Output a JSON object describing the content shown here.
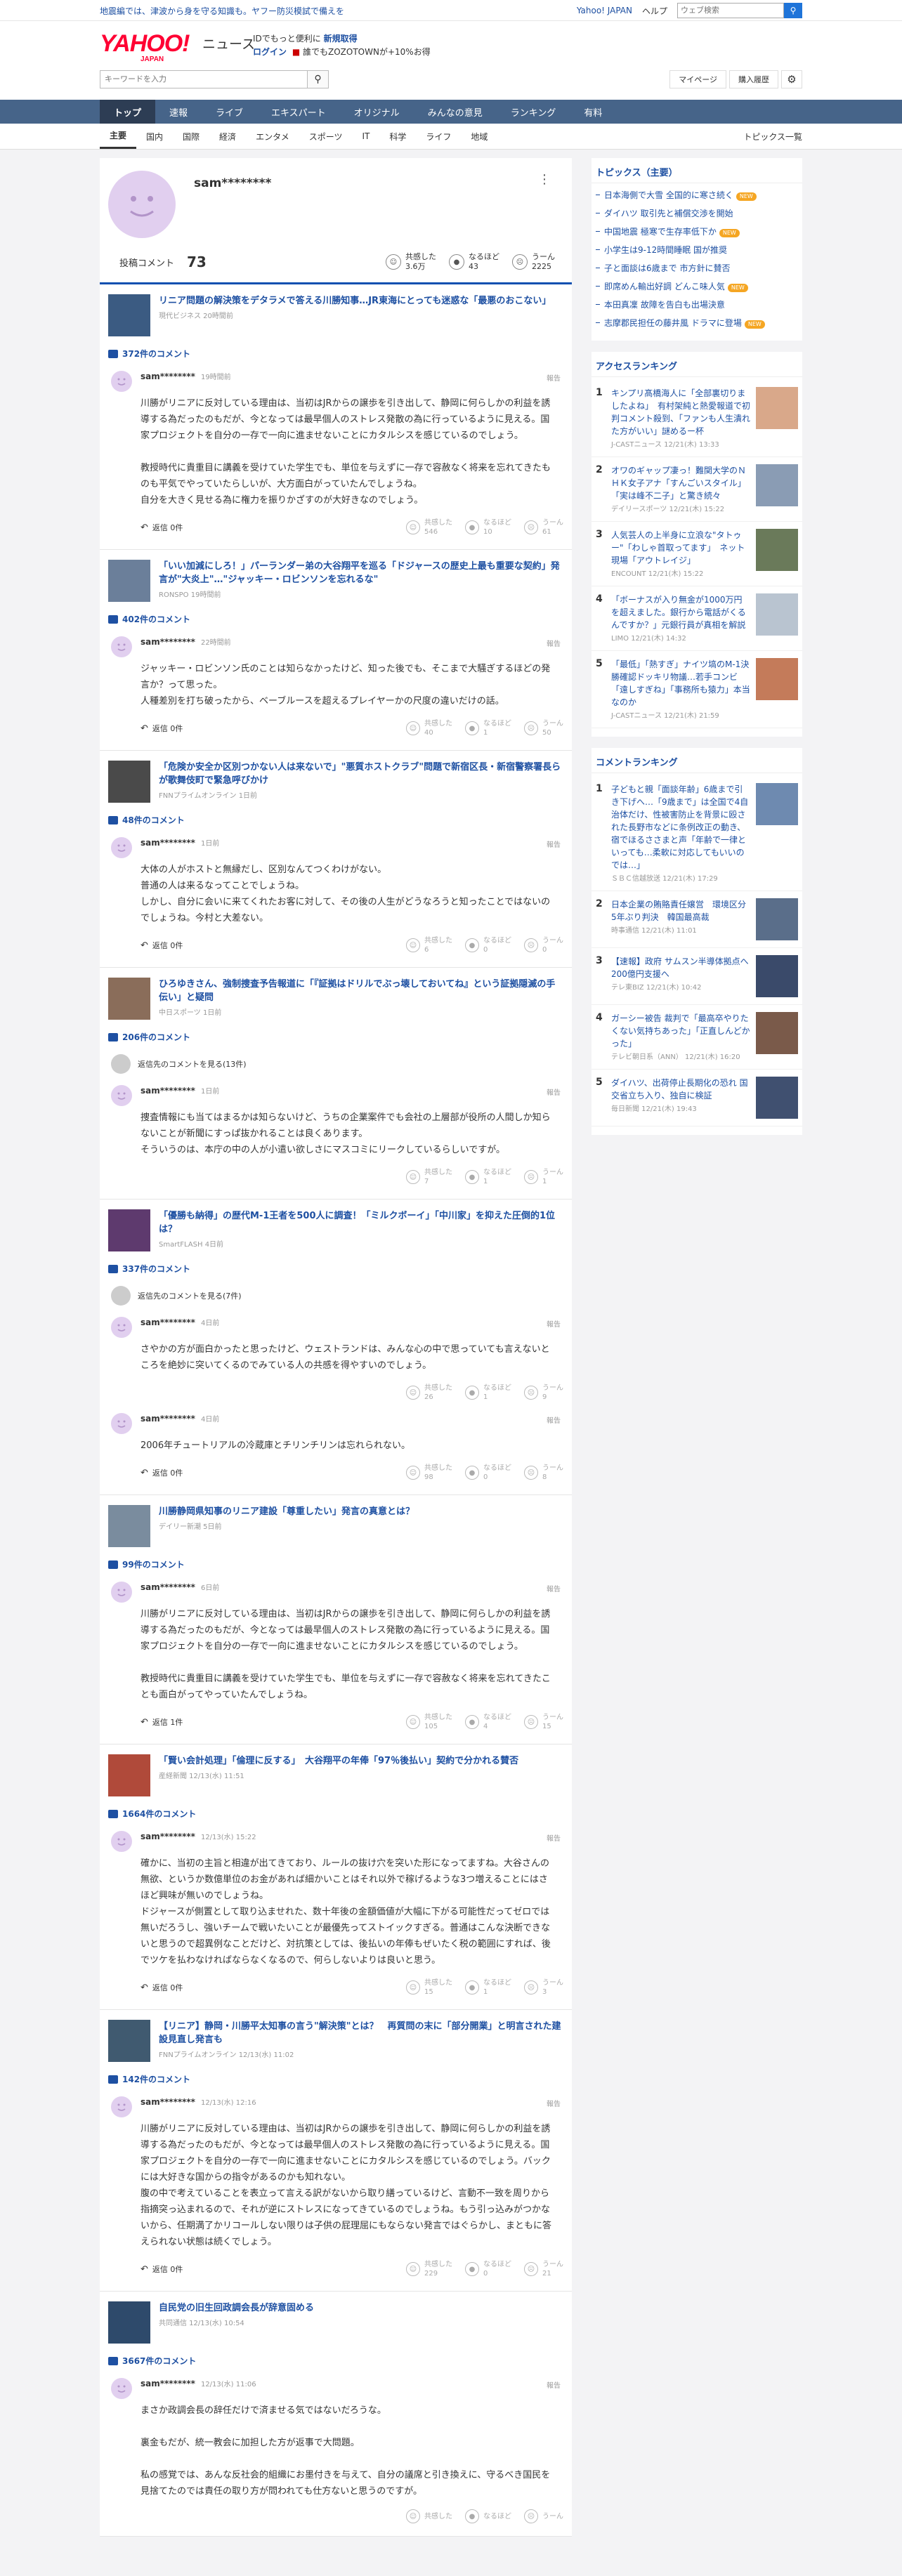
{
  "notice": {
    "text": "地震編では、津波から身を守る知識も。ヤフー防災模試で備えを",
    "yahoo_japan": "Yahoo! JAPAN",
    "help": "ヘルプ",
    "search_placeholder": "ウェブ検索"
  },
  "header": {
    "logo": "YAHOO!",
    "logo_sub": "JAPAN",
    "service": "ニュース",
    "promo1_a": "IDでもっと便利に",
    "promo1_b": "新規取得",
    "login": "ログイン",
    "promo2": "誰でもZOZOTOWNが+10%お得",
    "keyword_placeholder": "キーワードを入力",
    "mypage": "マイページ",
    "history": "購入履歴"
  },
  "nav_main": [
    "トップ",
    "速報",
    "ライブ",
    "エキスパート",
    "オリジナル",
    "みんなの意見",
    "ランキング",
    "有料"
  ],
  "nav_sub": [
    "主要",
    "国内",
    "国際",
    "経済",
    "エンタメ",
    "スポーツ",
    "IT",
    "科学",
    "ライフ",
    "地域"
  ],
  "nav_sub_all": "トピックス一覧",
  "profile": {
    "username": "sam********",
    "posts_label": "投稿コメント",
    "posts_count": "73",
    "reactions": [
      {
        "label": "共感した",
        "value": "3.6万"
      },
      {
        "label": "なるほど",
        "value": "43"
      },
      {
        "label": "うーん",
        "value": "2225"
      }
    ]
  },
  "labels": {
    "reply": "返信",
    "report": "報告",
    "agree": "共感した",
    "naruhodo": "なるほど",
    "uun": "うーん"
  },
  "articles": [
    {
      "title": "リニア問題の解決策をデタラメで答える川勝知事…JR東海にとっても迷惑な「最悪のおこない」",
      "source": "現代ビジネス 20時間前",
      "comment_count": "372件のコメント",
      "comments": [
        {
          "user": "sam********",
          "time": "19時間前",
          "body": "川勝がリニアに反対している理由は、当初はJRからの譲歩を引き出して、静岡に何らしかの利益を誘導する為だったのもだが、今となっては最早個人のストレス発散の為に行っているように見える。国家プロジェクトを自分の一存で一向に進ませないことにカタルシスを感じているのでしょう。\n\n教授時代に貴重目に講義を受けていた学生でも、単位を与えずに一存で容赦なく将来を忘れてきたものも平気でやっていたらしいが、大方面白がっていたんでしょうね。\n自分を大きく見せる為に権力を振りかざすのが大好きなのでしょう。",
          "replies": "返信 0件",
          "r": [
            "546",
            "10",
            "61"
          ]
        }
      ]
    },
    {
      "title": "「いい加減にしろ！」パーランダー弟の大谷翔平を巡る「ドジャースの歴史上最も重要な契約」発言が\"大炎上\"…\"ジャッキー・ロビンソンを忘れるな\"",
      "source": "RONSPO 19時間前",
      "comment_count": "402件のコメント",
      "comments": [
        {
          "user": "sam********",
          "time": "22時間前",
          "body": "ジャッキー・ロビンソン氏のことは知らなかったけど、知った後でも、そこまで大騒ぎするほどの発言か？って思った。\n人種差別を打ち破ったから、ベーブルースを超えるプレイヤーかの尺度の違いだけの話。",
          "replies": "返信 0件",
          "r": [
            "40",
            "1",
            "50"
          ]
        }
      ]
    },
    {
      "title": "「危険か安全か区別つかない人は来ないで」\"悪質ホストクラブ\"問題で新宿区長・新宿警察署長らが歌舞伎町で緊急呼びかけ",
      "source": "FNNプライムオンライン 1日前",
      "comment_count": "48件のコメント",
      "comments": [
        {
          "user": "sam********",
          "time": "1日前",
          "body": "大体の人がホストと無縁だし、区別なんてつくわけがない。\n普通の人は来るなってことでしょうね。\nしかし、自分に会いに来てくれたお客に対して、その後の人生がどうなろうと知ったことではないのでしょうね。今村と大差ない。",
          "replies": "返信 0件",
          "r": [
            "6",
            "0",
            "0"
          ]
        }
      ]
    },
    {
      "title": "ひろゆきさん、強制捜査予告報道に「『証拠はドリルでぶっ壊しておいてね』という証拠隠滅の手伝い」と疑問",
      "source": "中日スポーツ 1日前",
      "comment_count": "206件のコメント",
      "see_parent": "返信先のコメントを見る(13件)",
      "comments": [
        {
          "user": "sam********",
          "time": "1日前",
          "body": "捜査情報にも当てはまるかは知らないけど、うちの企業案件でも会社の上層部が役所の人間しか知らないことが新聞にすっぱ抜かれることは良くあります。\nそういうのは、本庁の中の人が小遣い欲しさにマスコミにリークしているらしいですが。",
          "replies": "",
          "r": [
            "7",
            "1",
            "1"
          ]
        }
      ]
    },
    {
      "title": "「優勝も納得」の歴代M-1王者を500人に調査！「ミルクボーイ」「中川家」を抑えた圧倒的1位は？",
      "source": "SmartFLASH 4日前",
      "comment_count": "337件のコメント",
      "see_parent": "返信先のコメントを見る(7件)",
      "comments": [
        {
          "user": "sam********",
          "time": "4日前",
          "body": "さやかの方が面白かったと思ったけど、ウェストランドは、みんな心の中で思っていても言えないところを絶妙に突いてくるのでみている人の共感を得やすいのでしょう。",
          "replies": "",
          "r": [
            "26",
            "1",
            "9"
          ]
        },
        {
          "user": "sam********",
          "time": "4日前",
          "body": "2006年チュートリアルの冷蔵庫とチリンチリンは忘れられない。",
          "replies": "返信 0件",
          "r": [
            "98",
            "0",
            "8"
          ]
        }
      ]
    },
    {
      "title": "川勝静岡県知事のリニア建設「尊重したい」発言の真意とは？",
      "source": "デイリー新潮 5日前",
      "comment_count": "99件のコメント",
      "comments": [
        {
          "user": "sam********",
          "time": "6日前",
          "body": "川勝がリニアに反対している理由は、当初はJRからの譲歩を引き出して、静岡に何らしかの利益を誘導する為だったのもだが、今となっては最早個人のストレス発散の為に行っているように見える。国家プロジェクトを自分の一存で一向に進ませないことにカタルシスを感じているのでしょう。\n\n教授時代に貴重目に講義を受けていた学生でも、単位を与えずに一存で容赦なく将来を忘れてきたことも面白がってやっていたんでしょうね。",
          "replies": "返信 1件",
          "r": [
            "105",
            "4",
            "15"
          ]
        }
      ]
    },
    {
      "title": "「賢い会計処理」「倫理に反する」　大谷翔平の年俸「97％後払い」契約で分かれる賛否",
      "source": "産経新聞 12/13(水) 11:51",
      "comment_count": "1664件のコメント",
      "comments": [
        {
          "user": "sam********",
          "time": "12/13(水) 15:22",
          "body": "確かに、当初の主旨と相違が出てきており、ルールの抜け穴を突いた形になってますね。大谷さんの無欲、というか数億単位のお金があれば細かいことはそれ以外で稼げるような3つ増えることにはさほど興味が無いのでしょうね。\nドジャースが側置として取り込ませれた、数十年後の金額価値が大幅に下がる可能性だってゼロでは無いだろうし、強いチームで戦いたいことが最優先ってストイックすぎる。普通はこんな決断できないと思うので超異例なことだけど、対抗策としては、後払いの年俸もぜいたく税の範囲にすれば、後でツケを払わなければならなくなるので、何らしないよりは良いと思う。",
          "replies": "返信 0件",
          "r": [
            "15",
            "1",
            "3"
          ]
        }
      ]
    },
    {
      "title": "【リニア】静岡・川勝平太知事の言う\"解決策\"とは？　再質問の末に「部分開業」と明言された建設見直し発言も",
      "source": "FNNプライムオンライン 12/13(水) 11:02",
      "comment_count": "142件のコメント",
      "comments": [
        {
          "user": "sam********",
          "time": "12/13(水) 12:16",
          "body": "川勝がリニアに反対している理由は、当初はJRからの譲歩を引き出して、静岡に何らしかの利益を誘導する為だったのもだが、今となっては最早個人のストレス発散の為に行っているように見える。国家プロジェクトを自分の一存で一向に進ませないことにカタルシスを感じているのでしょう。バックには大好きな国からの指令があるのかも知れない。\n腹の中で考えていることを表立って言える訳がないから取り繕っているけど、言動不一致を周りから指摘突っ込まれるので、それが逆にストレスになってきているのでしょうね。もう引っ込みがつかないから、任期満了かリコールしない限りは子供の屁理屈にもならない発言ではぐらかし、まともに答えられない状態は続くでしょう。",
          "replies": "返信 0件",
          "r": [
            "229",
            "0",
            "21"
          ]
        }
      ]
    },
    {
      "title": "自民党の旧生回政調会長が辞意固める",
      "source": "共同通信 12/13(水) 10:54",
      "comment_count": "3667件のコメント",
      "comments": [
        {
          "user": "sam********",
          "time": "12/13(水) 11:06",
          "body": "まさか政調会長の辞任だけで済ませる気ではないだろうな。\n\n裏金もだが、統一教会に加担した方が返事で大問題。\n\n私の感覚では、あんな反社会的組織にお墨付きを与えて、自分の議席と引き換えに、守るべき国民を見捨てたのでは責任の取り方が問われても仕方ないと思うのですが。",
          "replies": "",
          "r": [
            "",
            "",
            ""
          ]
        }
      ]
    }
  ],
  "sidebar": {
    "topics_title": "トピックス（主要）",
    "topics": [
      {
        "t": "日本海側で大雪 全国的に寒さ続く",
        "tag": "NEW"
      },
      {
        "t": "ダイハツ 取引先と補償交渉を開始",
        "tag": ""
      },
      {
        "t": "中国地震 極寒で生存率低下か",
        "tag": "NEW"
      },
      {
        "t": "小学生は9-12時間睡眠 国が推奨",
        "tag": ""
      },
      {
        "t": "子と面談は6歳まで 市方針に賛否",
        "tag": ""
      },
      {
        "t": "即席めん輸出好調 どんこ味人気",
        "tag": "NEW"
      },
      {
        "t": "本田真凜 故障を告白も出場決意",
        "tag": ""
      },
      {
        "t": "志摩郡民担任の藤井風 ドラマに登場",
        "tag": "NEW"
      }
    ],
    "access_title": "アクセスランキング",
    "access": [
      {
        "no": "1",
        "t": "キンプリ髙橋海人に「全部裏切りましたよね」　有村架純と熱愛報道で初判コメント殺到、「ファンも人生潰れた方がいい」謎めるー杯",
        "s": "J-CASTニュース 12/21(木) 13:33"
      },
      {
        "no": "2",
        "t": "オワのギャップ凄っ！難関大学のＮＨＫ女子アナ「すんごいスタイル」「実は峰不二子」と驚き続々",
        "s": "デイリースポーツ 12/21(木) 15:22"
      },
      {
        "no": "3",
        "t": "人気芸人の上半身に立浪な\"タトゥー\"「わしゃ首取ってます」　ネット現場「アウトレイジ」",
        "s": "ENCOUNT 12/21(木) 15:22"
      },
      {
        "no": "4",
        "t": "「ボーナスが入り無金が1000万円を超えました。銀行から電話がくるんですか？」元銀行員が真相を解説",
        "s": "LIMO 12/21(木) 14:32"
      },
      {
        "no": "5",
        "t": "「最低」「熱すぎ」ナイツ塙のM-1決勝確認ドッキリ物議…若手コンビ「遠しすぎね」「事務所も猿力」本当なのか",
        "s": "J-CASTニュース 12/21(木) 21:59"
      }
    ],
    "comment_title": "コメントランキング",
    "comments": [
      {
        "no": "1",
        "t": "子どもと親「面談年齢」6歳まで引き下げへ…「9歳まで」は全国で4自治体だけ、性被害防止を背景に殴された長野市などに条例改正の動き、宿でほるささまと声「年齢で一律といっても…柔軟に対応してもいいのでは…」",
        "s": "ＳＢＣ信越放送 12/21(木) 17:29"
      },
      {
        "no": "2",
        "t": "日本企業の賄賂責任嬢営　環境区分5年ぶり判決　韓国最高裁",
        "s": "時事通信 12/21(木) 11:01"
      },
      {
        "no": "3",
        "t": "【速報】政府 サムスン半導体拠点へ200億円支援へ",
        "s": "テレ東BIZ 12/21(木) 10:42"
      },
      {
        "no": "4",
        "t": "ガーシー被告 裁判で「最高卒やりたくない気持ちあった」「正直しんどかった」",
        "s": "テレビ朝日系（ANN） 12/21(木) 16:20"
      },
      {
        "no": "5",
        "t": "ダイハツ、出荷停止長期化の恐れ 国交省立ち入り、独自に検証",
        "s": "毎日新聞 12/21(木) 19:43"
      }
    ]
  },
  "colors": {
    "brand": "#ff0033",
    "nav": "#466489",
    "link": "#1e50a2",
    "accent": "#0d50b0"
  }
}
